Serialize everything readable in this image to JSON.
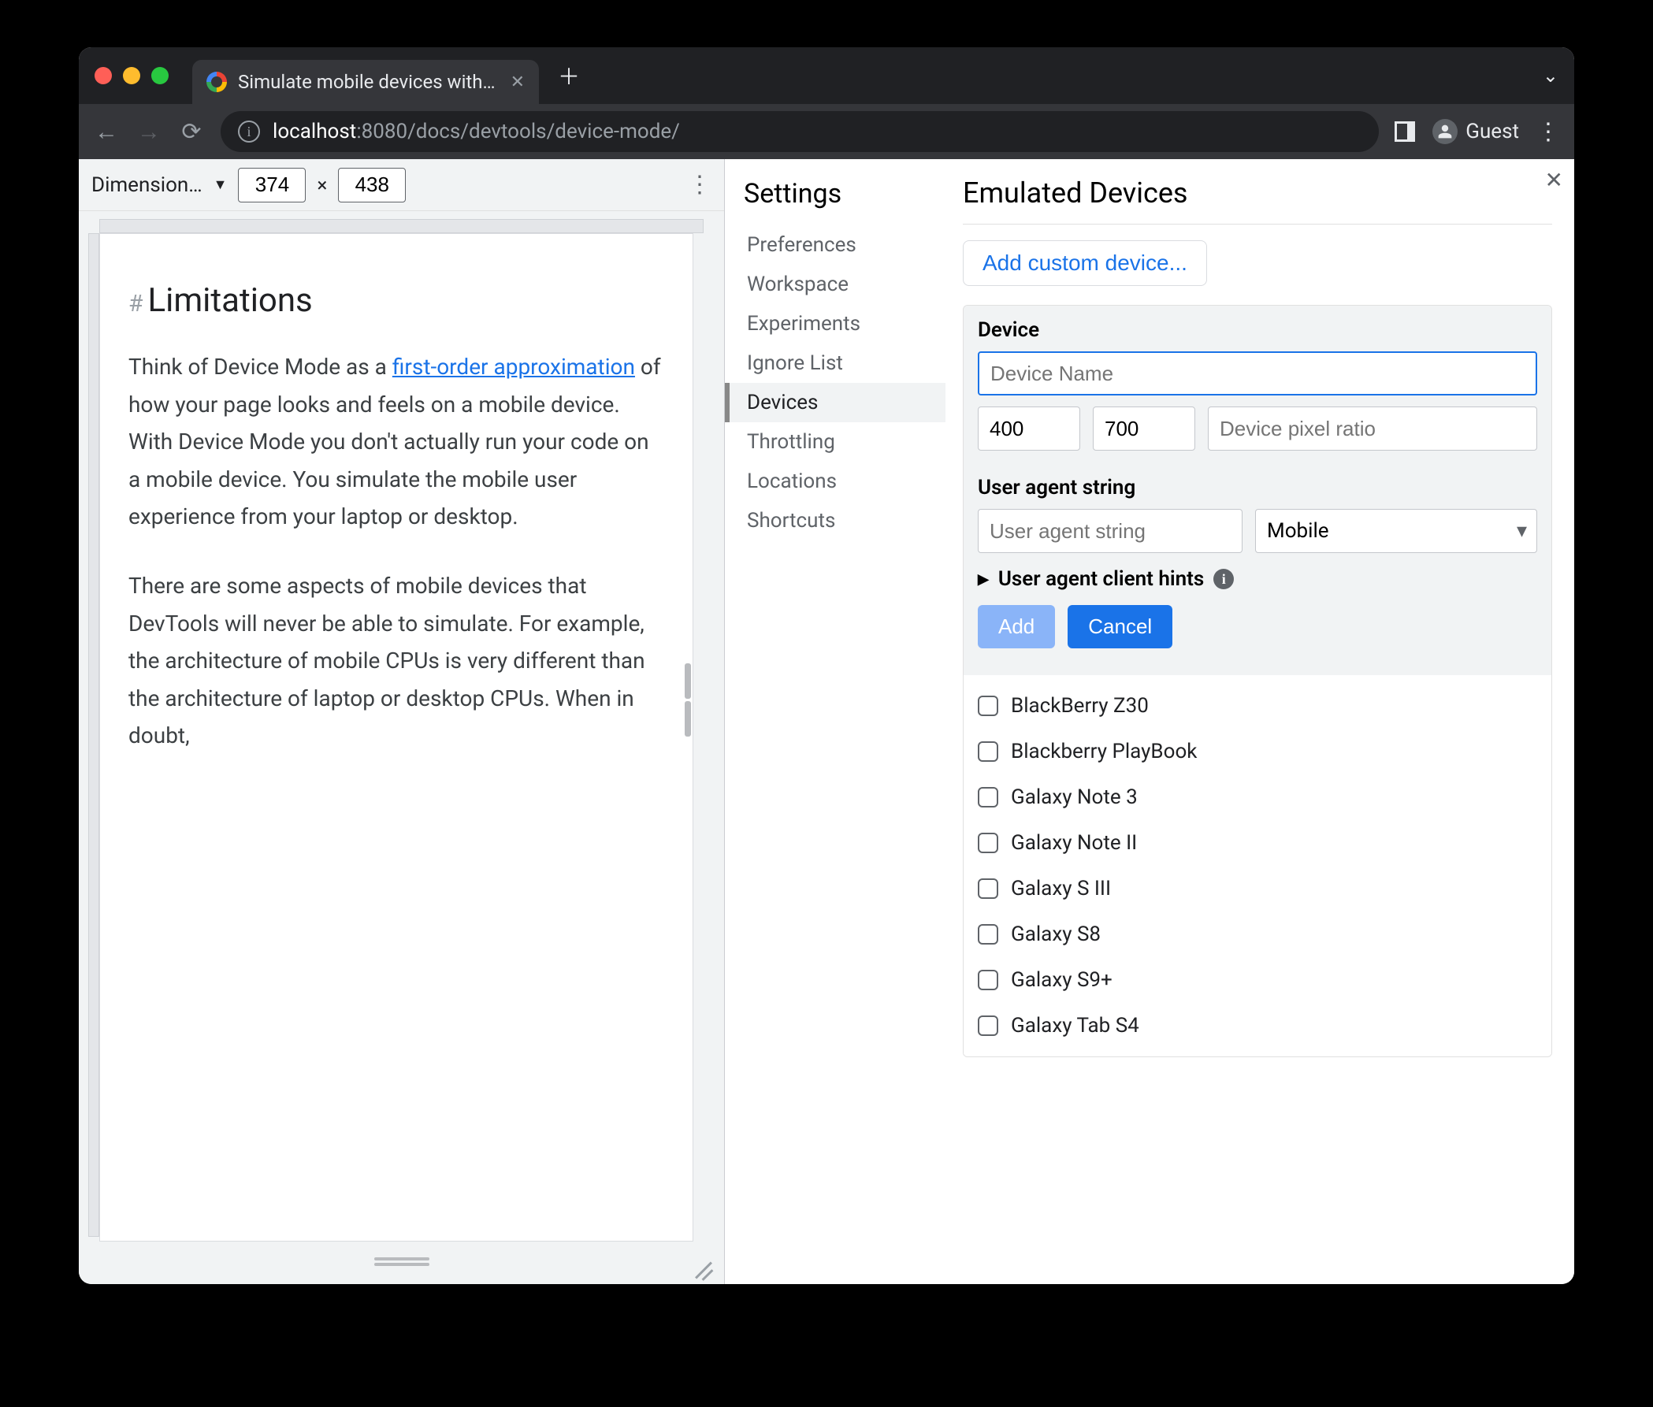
{
  "tab": {
    "title": "Simulate mobile devices with D"
  },
  "address": {
    "host": "localhost",
    "port": ":8080",
    "path": "/docs/devtools/device-mode/",
    "guest_label": "Guest"
  },
  "device_toolbar": {
    "dimensions_label": "Dimension…",
    "width": "374",
    "height": "438",
    "separator": "×"
  },
  "page": {
    "heading_hash": "#",
    "heading": "Limitations",
    "para1_pre": "Think of Device Mode as a ",
    "para1_link": "first-order approximation",
    "para1_post": " of how your page looks and feels on a mobile device. With Device Mode you don't actually run your code on a mobile device. You simulate the mobile user experience from your laptop or desktop.",
    "para2": "There are some aspects of mobile devices that DevTools will never be able to simulate. For example, the architecture of mobile CPUs is very different than the architecture of laptop or desktop CPUs. When in doubt,"
  },
  "settings": {
    "title": "Settings",
    "items": [
      "Preferences",
      "Workspace",
      "Experiments",
      "Ignore List",
      "Devices",
      "Throttling",
      "Locations",
      "Shortcuts"
    ],
    "active_index": 4
  },
  "emulated": {
    "title": "Emulated Devices",
    "add_custom": "Add custom device...",
    "device_section_label": "Device",
    "device_name_placeholder": "Device Name",
    "width_value": "400",
    "height_value": "700",
    "dpr_placeholder": "Device pixel ratio",
    "ua_section_label": "User agent string",
    "ua_placeholder": "User agent string",
    "ua_type_value": "Mobile",
    "hints_label": "User agent client hints",
    "btn_add": "Add",
    "btn_cancel": "Cancel",
    "devices": [
      "BlackBerry Z30",
      "Blackberry PlayBook",
      "Galaxy Note 3",
      "Galaxy Note II",
      "Galaxy S III",
      "Galaxy S8",
      "Galaxy S9+",
      "Galaxy Tab S4"
    ]
  }
}
